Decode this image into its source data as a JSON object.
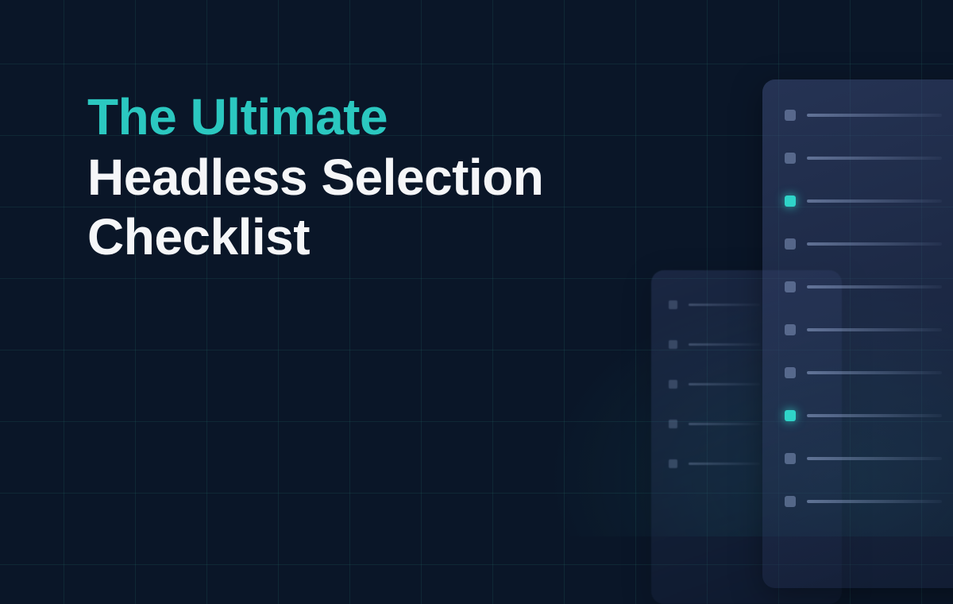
{
  "headline": {
    "accent": "The Ultimate",
    "line2": "Headless Selection",
    "line3": "Checklist"
  },
  "colors": {
    "accent": "#2bc8c0",
    "background": "#0a1628"
  }
}
